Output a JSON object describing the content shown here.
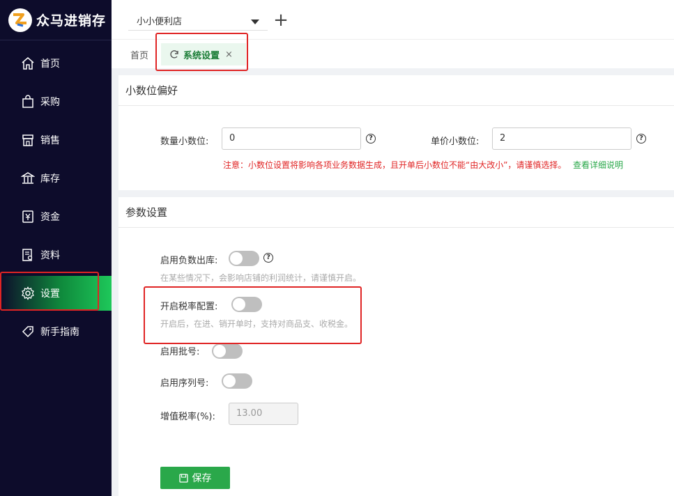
{
  "app": {
    "brand": "众马进销存"
  },
  "sidebar": {
    "items": [
      {
        "label": "首页",
        "icon": "home-icon"
      },
      {
        "label": "采购",
        "icon": "shopping-bag-icon"
      },
      {
        "label": "销售",
        "icon": "store-icon"
      },
      {
        "label": "库存",
        "icon": "warehouse-icon"
      },
      {
        "label": "资金",
        "icon": "yen-icon"
      },
      {
        "label": "资料",
        "icon": "document-icon"
      },
      {
        "label": "设置",
        "icon": "gear-icon",
        "active": true
      },
      {
        "label": "新手指南",
        "icon": "tag-icon"
      }
    ]
  },
  "topbar": {
    "store": "小小便利店",
    "add_label": "+"
  },
  "tabs": {
    "home": "首页",
    "active": {
      "label": "系统设置",
      "close": "×"
    }
  },
  "decimal": {
    "title": "小数位偏好",
    "qty_label": "数量小数位:",
    "qty_value": "0",
    "price_label": "单价小数位:",
    "price_value": "2",
    "warning": "注意：小数位设置将影响各项业务数据生成，且开单后小数位不能“由大改小”，请谨慎选择。",
    "detail_link": "查看详细说明"
  },
  "params": {
    "title": "参数设置",
    "negative_stock": {
      "label": "启用负数出库:",
      "hint": "在某些情况下，会影响店铺的利润统计，请谨慎开启。",
      "on": false
    },
    "tax_rate": {
      "label": "开启税率配置:",
      "hint": "开启后，在进、销开单时，支持对商品支、收税金。",
      "on": false
    },
    "batch": {
      "label": "启用批号:",
      "on": false
    },
    "serial": {
      "label": "启用序列号:",
      "on": false
    },
    "vat": {
      "label": "增值税率(%):",
      "value": "13.00"
    },
    "save_label": "保存"
  },
  "colors": {
    "accent": "#2aa84a",
    "sidebar_bg": "#0d0c2b",
    "highlight": "#e02424",
    "warning": "#e02424"
  }
}
